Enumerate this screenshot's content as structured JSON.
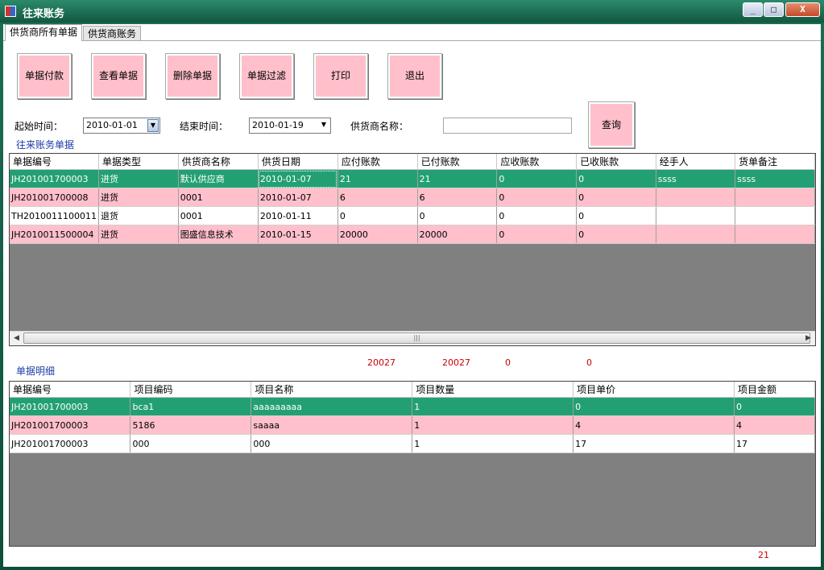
{
  "window": {
    "title": "往来账务",
    "minimize": "_",
    "maximize": "□",
    "close": "X"
  },
  "tabs": [
    "供货商所有单据",
    "供货商账务"
  ],
  "buttons": {
    "pay": "单据付款",
    "view": "查看单据",
    "delete": "删除单据",
    "filter": "单据过滤",
    "print": "打印",
    "exit": "退出",
    "query": "查询"
  },
  "filters": {
    "start_label": "起始时间：",
    "start_value": "2010-01-01",
    "end_label": "结束时间：",
    "end_value": "2010-01-19",
    "supplier_label": "供货商名称：",
    "supplier_value": ""
  },
  "section_titles": {
    "accounts": "往来账务单据",
    "details": "单据明细"
  },
  "accounts_table": {
    "columns": [
      "单据编号",
      "单据类型",
      "供货商名称",
      "供货日期",
      "应付账款",
      "已付账款",
      "应收账款",
      "已收账款",
      "经手人",
      "货单备注"
    ],
    "rows": [
      [
        "JH201001700003",
        "进货",
        "默认供应商",
        "2010-01-07",
        "21",
        "21",
        "0",
        "0",
        "ssss",
        "ssss"
      ],
      [
        "JH201001700008",
        "进货",
        "0001",
        "2010-01-07",
        "6",
        "6",
        "0",
        "0",
        "",
        ""
      ],
      [
        "TH2010011100011",
        "退货",
        "0001",
        "2010-01-11",
        "0",
        "0",
        "0",
        "0",
        "",
        ""
      ],
      [
        "JH2010011500004",
        "进货",
        "图盛信息技术",
        "2010-01-15",
        "20000",
        "20000",
        "0",
        "0",
        "",
        ""
      ]
    ]
  },
  "totals": {
    "payable": "20027",
    "paid": "20027",
    "receivable": "0",
    "received": "0"
  },
  "details_table": {
    "columns": [
      "单据编号",
      "项目编码",
      "项目名称",
      "项目数量",
      "项目单价",
      "项目金额"
    ],
    "rows": [
      [
        "JH201001700003",
        "bca1",
        "aaaaaaaaa",
        "1",
        "0",
        "0"
      ],
      [
        "JH201001700003",
        "5186",
        "saaaa",
        "1",
        "4",
        "4"
      ],
      [
        "JH201001700003",
        "000",
        "000",
        "1",
        "17",
        "17"
      ]
    ]
  },
  "details_total": "21",
  "colors": {
    "selected_row": "#23a073",
    "pink_row": "#ffc0cb",
    "title_bar": "#1e6d55"
  }
}
